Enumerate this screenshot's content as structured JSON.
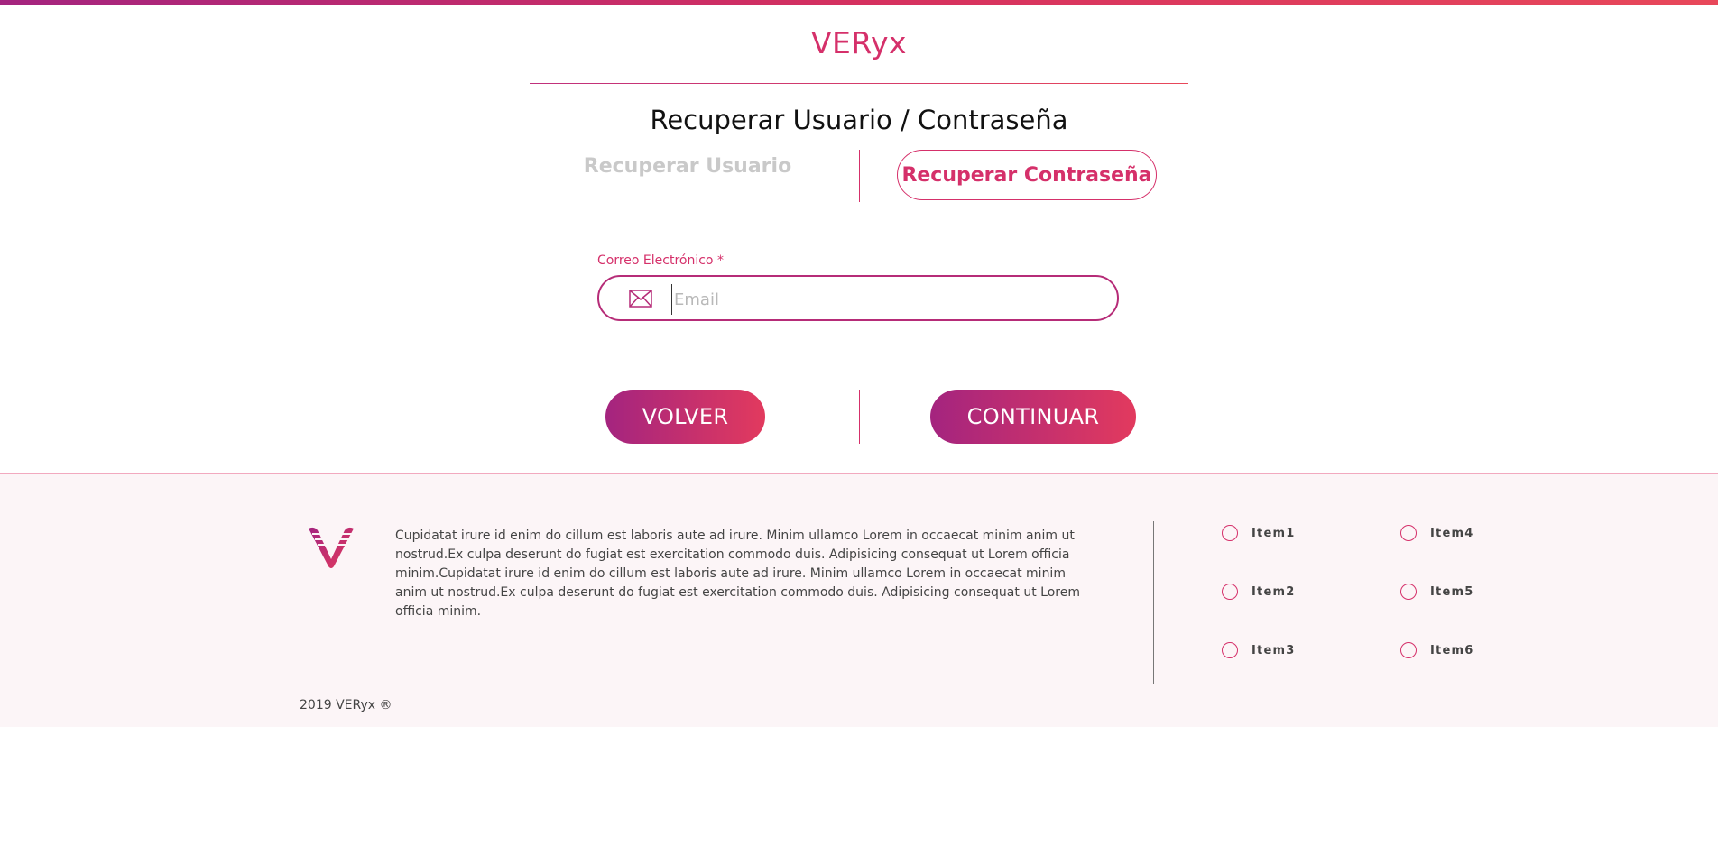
{
  "brand": "VERyx",
  "page_title": "Recuperar Usuario / Contraseña",
  "tabs": {
    "recover_user": "Recuperar Usuario",
    "recover_password": "Recuperar Contraseña"
  },
  "form": {
    "email_label": "Correo Electrónico *",
    "email_value": "",
    "email_placeholder": "Email",
    "email_icon": "envelope-icon"
  },
  "buttons": {
    "back": "VOLVER",
    "continue": "CONTINUAR"
  },
  "footer": {
    "logo_icon": "veryx-v-logo",
    "text": "Cupidatat irure id enim do cillum est laboris aute ad irure. Minim ullamco Lorem in occaecat minim anim ut nostrud.Ex culpa deserunt do fugiat est exercitation commodo duis. Adipisicing consequat ut Lorem officia minim.Cupidatat irure id enim do cillum est laboris aute ad irure. Minim ullamco Lorem in occaecat minim anim ut nostrud.Ex culpa deserunt do fugiat est exercitation commodo duis. Adipisicing consequat ut Lorem officia minim.",
    "items": [
      "Item1",
      "Item2",
      "Item3",
      "Item4",
      "Item5",
      "Item6"
    ],
    "copyright": "2019 VERyx ®"
  },
  "colors": {
    "accent": "#d5306a",
    "gradient_start": "#a4247f",
    "gradient_end": "#e23a5e",
    "footer_bg": "#fcf5f7"
  }
}
